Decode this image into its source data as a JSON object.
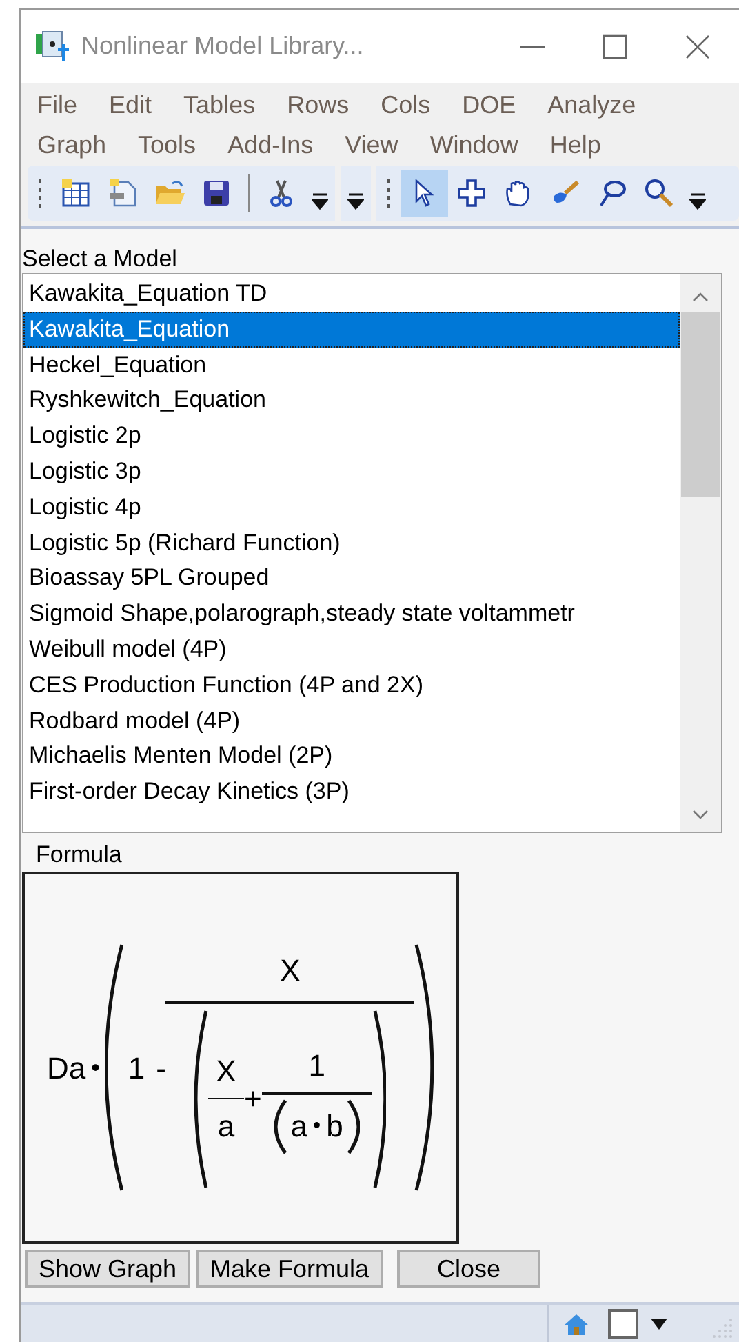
{
  "window": {
    "title": "Nonlinear Model Library..."
  },
  "menu": [
    {
      "label": "File"
    },
    {
      "label": "Edit"
    },
    {
      "label": "Tables"
    },
    {
      "label": "Rows"
    },
    {
      "label": "Cols"
    },
    {
      "label": "DOE"
    },
    {
      "label": "Analyze"
    },
    {
      "label": "Graph"
    },
    {
      "label": "Tools"
    },
    {
      "label": "Add-Ins"
    },
    {
      "label": "View"
    },
    {
      "label": "Window"
    },
    {
      "label": "Help"
    }
  ],
  "toolbar": [
    {
      "kind": "grip"
    },
    {
      "kind": "new-table",
      "selected": false
    },
    {
      "kind": "new-doc",
      "selected": false
    },
    {
      "kind": "open",
      "selected": false
    },
    {
      "kind": "save",
      "selected": false
    },
    {
      "kind": "sep"
    },
    {
      "kind": "cut",
      "selected": false
    },
    {
      "kind": "overflow"
    },
    {
      "kind": "gap"
    },
    {
      "kind": "overflow"
    },
    {
      "kind": "gap"
    },
    {
      "kind": "grip"
    },
    {
      "kind": "arrow",
      "selected": true
    },
    {
      "kind": "cross",
      "selected": false
    },
    {
      "kind": "hand",
      "selected": false
    },
    {
      "kind": "brush",
      "selected": false
    },
    {
      "kind": "lasso",
      "selected": false
    },
    {
      "kind": "magnifier",
      "selected": false
    },
    {
      "kind": "overflow"
    }
  ],
  "model_list": {
    "label": "Select a Model",
    "items": [
      {
        "label": "Kawakita_Equation TD",
        "selected": false
      },
      {
        "label": "Kawakita_Equation",
        "selected": true
      },
      {
        "label": "Heckel_Equation",
        "selected": false
      },
      {
        "label": "Ryshkewitch_Equation",
        "selected": false
      },
      {
        "label": "Logistic 2p",
        "selected": false
      },
      {
        "label": "Logistic 3p",
        "selected": false
      },
      {
        "label": "Logistic 4p",
        "selected": false
      },
      {
        "label": "Logistic 5p (Richard Function)",
        "selected": false
      },
      {
        "label": "Bioassay 5PL Grouped",
        "selected": false
      },
      {
        "label": "Sigmoid Shape,polarograph,steady state voltammetr",
        "selected": false
      },
      {
        "label": "Weibull model (4P)",
        "selected": false
      },
      {
        "label": "CES Production Function (4P and 2X)",
        "selected": false
      },
      {
        "label": "Rodbard model (4P)",
        "selected": false
      },
      {
        "label": "Michaelis Menten Model (2P)",
        "selected": false
      },
      {
        "label": "First-order Decay Kinetics (3P)",
        "selected": false
      }
    ]
  },
  "formula": {
    "label": "Formula",
    "factor": "Da",
    "dot": "•",
    "one": "1",
    "minus": "-",
    "numerator": "X",
    "inner": {
      "x": "X",
      "a": "a",
      "plus": "+",
      "one": "1",
      "a2": "a",
      "dot": "•",
      "b": "b"
    }
  },
  "buttons": [
    {
      "label": "Show Graph"
    },
    {
      "label": "Make Formula"
    },
    {
      "label": "Close"
    }
  ]
}
